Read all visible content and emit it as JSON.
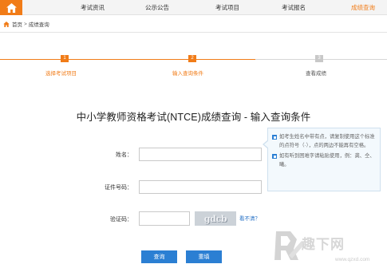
{
  "nav": {
    "items": [
      {
        "label": "考试资讯"
      },
      {
        "label": "公示公告"
      },
      {
        "label": "考试项目"
      },
      {
        "label": "考试报名"
      },
      {
        "label": "成绩查询"
      }
    ],
    "active_color": "#f17c18"
  },
  "breadcrumb": {
    "home": "首页",
    "separator": ">",
    "current": "成绩查询"
  },
  "steps": [
    {
      "num": "1",
      "label": "选择考试项目",
      "state": "done"
    },
    {
      "num": "2",
      "label": "输入查询条件",
      "state": "active"
    },
    {
      "num": "3",
      "label": "查看成绩",
      "state": "pending"
    }
  ],
  "title": "中小学教师资格考试(NTCE)成绩查询 - 输入查询条件",
  "form": {
    "name_label": "姓名：",
    "name_value": "",
    "id_label": "证件号码：",
    "id_value": "",
    "captcha_label": "验证码：",
    "captcha_value": "",
    "captcha_image_text": "gdcb",
    "captcha_refresh": "看不清？"
  },
  "tips": [
    "如考生姓名中带有点，请复制使用这个标准的点符号（·），点的两边不能再有空格。",
    "如有听到困难字请粘贴使用，例：龚、仝、曦。"
  ],
  "buttons": {
    "query": "查询",
    "reset": "重填"
  },
  "watermark": {
    "text": "趣下网",
    "url": "www.qzxd.com"
  },
  "colors": {
    "accent": "#f17c18",
    "primary_blue": "#2b7fd3",
    "step_pending": "#c8c8c8"
  }
}
